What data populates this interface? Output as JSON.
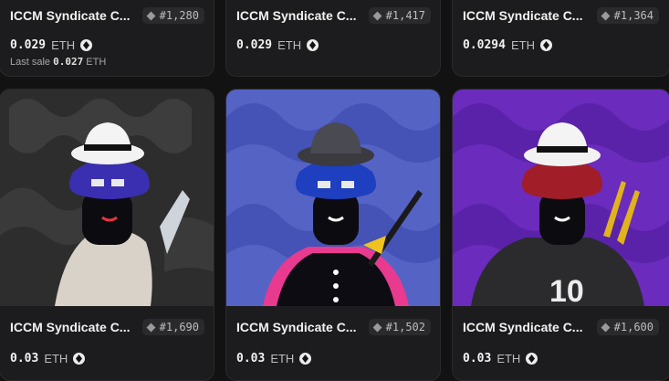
{
  "cards": [
    {
      "name": "ICCM Syndicate C...",
      "rank": "#1,280",
      "price": "0.029",
      "currency": "ETH",
      "last_sale_label": "Last sale",
      "last_sale_value": "0.027",
      "last_sale_currency": "ETH"
    },
    {
      "name": "ICCM Syndicate C...",
      "rank": "#1,417",
      "price": "0.029",
      "currency": "ETH"
    },
    {
      "name": "ICCM Syndicate C...",
      "rank": "#1,364",
      "price": "0.0294",
      "currency": "ETH"
    },
    {
      "name": "ICCM Syndicate C...",
      "rank": "#1,690",
      "price": "0.03",
      "currency": "ETH",
      "art_bg": "#2d2d2d",
      "jersey_number": ""
    },
    {
      "name": "ICCM Syndicate C...",
      "rank": "#1,502",
      "price": "0.03",
      "currency": "ETH",
      "art_bg": "#5563c5"
    },
    {
      "name": "ICCM Syndicate C...",
      "rank": "#1,600",
      "price": "0.03",
      "currency": "ETH",
      "art_bg": "#6b2bbd",
      "jersey_number": "10"
    }
  ],
  "colors": {
    "page_bg": "#121212",
    "card_bg": "#1c1c1e",
    "badge_bg": "#2a2a2d"
  },
  "icons": {
    "rank": "diamond-icon",
    "currency": "eth-icon"
  }
}
